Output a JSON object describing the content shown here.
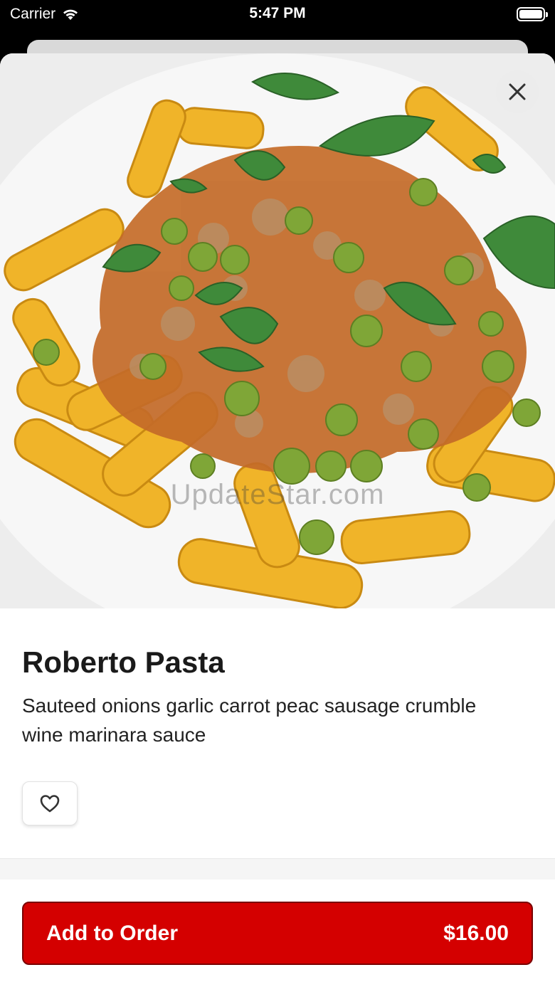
{
  "status_bar": {
    "carrier": "Carrier",
    "time": "5:47 PM"
  },
  "hero": {
    "watermark": "UpdateStar.com"
  },
  "item": {
    "title": "Roberto Pasta",
    "description": "Sauteed onions garlic carrot peac sausage crumble wine marinara sauce"
  },
  "actions": {
    "add_to_order_label": "Add to Order",
    "price": "$16.00"
  },
  "colors": {
    "accent": "#d40000",
    "pasta": "#f0b429",
    "peas": "#7fa637",
    "sauce": "#c8702a",
    "basil": "#3f8a3a"
  },
  "icons": {
    "close": "close-icon",
    "favorite": "heart-outline-icon",
    "wifi": "wifi-icon",
    "battery": "battery-icon"
  }
}
